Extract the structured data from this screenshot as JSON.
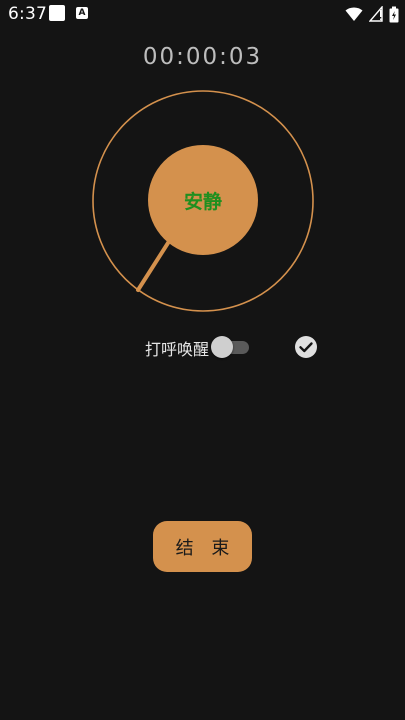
{
  "status_bar": {
    "time": "6:37",
    "notification_badge": "A",
    "icons": [
      "notification-square-icon",
      "font-badge-icon",
      "wifi-icon",
      "signal-icon",
      "battery-icon"
    ]
  },
  "timer": {
    "value": "00:00:03"
  },
  "dial": {
    "status_label": "安静",
    "accent_color": "#d4914d",
    "status_color": "#1f8f1f"
  },
  "snore_wake": {
    "label": "打呼唤醒",
    "enabled": false
  },
  "actions": {
    "end_label": "结 束"
  }
}
